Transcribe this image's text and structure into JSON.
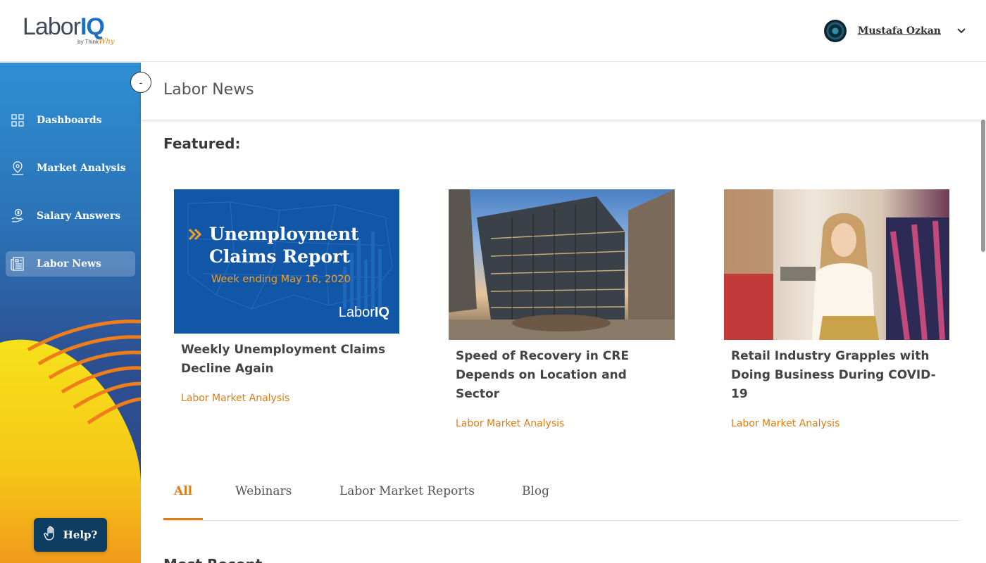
{
  "brand": {
    "logo_main": "Labor",
    "logo_accent": "IQ",
    "logo_sub": "by Think",
    "logo_sub_accent": "Why"
  },
  "user": {
    "name": "Mustafa Ozkan"
  },
  "sidebar": {
    "items": [
      {
        "label": "Dashboards",
        "icon": "grid-icon",
        "active": false
      },
      {
        "label": "Market Analysis",
        "icon": "map-pin-icon",
        "active": false
      },
      {
        "label": "Salary Answers",
        "icon": "salary-hand-icon",
        "active": false
      },
      {
        "label": "Labor News",
        "icon": "newspaper-icon",
        "active": true
      }
    ],
    "collapse_label": "-",
    "help_label": "Help?"
  },
  "page": {
    "title": "Labor News",
    "featured_heading": "Featured:",
    "most_recent_heading": "Most Recent"
  },
  "featured": [
    {
      "image_headline_line1": "Unemployment",
      "image_headline_line2": "Claims Report",
      "image_subline": "Week ending May 16, 2020",
      "image_logo_main": "Labor",
      "image_logo_accent": "IQ",
      "title": "Weekly Unemployment Claims Decline Again",
      "category": "Labor Market Analysis"
    },
    {
      "title": "Speed of Recovery in CRE Depends on Location and Sector",
      "category": "Labor Market Analysis"
    },
    {
      "title": "Retail Industry Grapples with Doing Business During COVID-19",
      "category": "Labor Market Analysis"
    }
  ],
  "tabs": [
    {
      "label": "All",
      "active": true
    },
    {
      "label": "Webinars",
      "active": false
    },
    {
      "label": "Labor Market Reports",
      "active": false
    },
    {
      "label": "Blog",
      "active": false
    }
  ],
  "colors": {
    "accent_orange": "#e07b14",
    "brand_blue": "#1f6fbf",
    "help_button": "#0e3d63"
  }
}
